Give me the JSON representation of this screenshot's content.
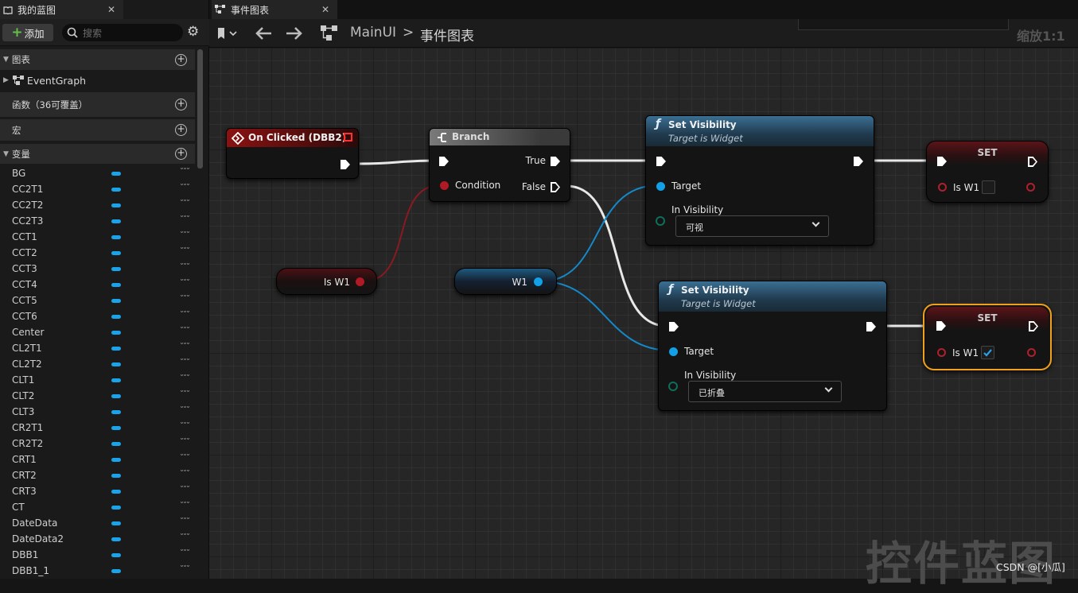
{
  "tabs": {
    "blueprint": "我的蓝图",
    "graph": "事件图表"
  },
  "toolbar": {
    "add_label": "添加",
    "search_placeholder": "搜索"
  },
  "sections": {
    "graphs": "图表",
    "functions": "函数（36可覆盖）",
    "macros": "宏",
    "variables": "变量"
  },
  "event_graph_label": "EventGraph",
  "variables": [
    "BG",
    "CC2T1",
    "CC2T2",
    "CC2T3",
    "CCT1",
    "CCT2",
    "CCT3",
    "CCT4",
    "CCT5",
    "CCT6",
    "Center",
    "CL2T1",
    "CL2T2",
    "CLT1",
    "CLT2",
    "CLT3",
    "CR2T1",
    "CR2T2",
    "CRT1",
    "CRT2",
    "CRT3",
    "CT",
    "DateData",
    "DateData2",
    "DBB1",
    "DBB1_1"
  ],
  "breadcrumb": {
    "blueprint": "MainUI",
    "sep": ">",
    "graph": "事件图表"
  },
  "zoom_label": "缩放1:1",
  "nodes": {
    "on_clicked": {
      "title": "On Clicked (DBB2)"
    },
    "branch": {
      "title": "Branch",
      "condition": "Condition",
      "true_label": "True",
      "false_label": "False"
    },
    "get_isw1": {
      "label": "Is W1"
    },
    "get_w1": {
      "label": "W1"
    },
    "set_visibility_1": {
      "title": "Set Visibility",
      "subtitle": "Target is Widget",
      "target": "Target",
      "in_visibility": "In Visibility",
      "value": "可视"
    },
    "set_visibility_2": {
      "title": "Set Visibility",
      "subtitle": "Target is Widget",
      "target": "Target",
      "in_visibility": "In Visibility",
      "value": "已折叠"
    },
    "set_1": {
      "title": "SET",
      "var": "Is W1",
      "checked": false
    },
    "set_2": {
      "title": "SET",
      "var": "Is W1",
      "checked": true
    }
  },
  "watermark": {
    "title": "控件蓝图",
    "credit": "CSDN @[小瓜]"
  },
  "colors": {
    "exec": "#ffffff",
    "bool": "#a01a23",
    "object": "#12a0e6",
    "selected": "#f0a01c",
    "event_header": "#7a1010",
    "function_header": "#2d5b7a"
  }
}
